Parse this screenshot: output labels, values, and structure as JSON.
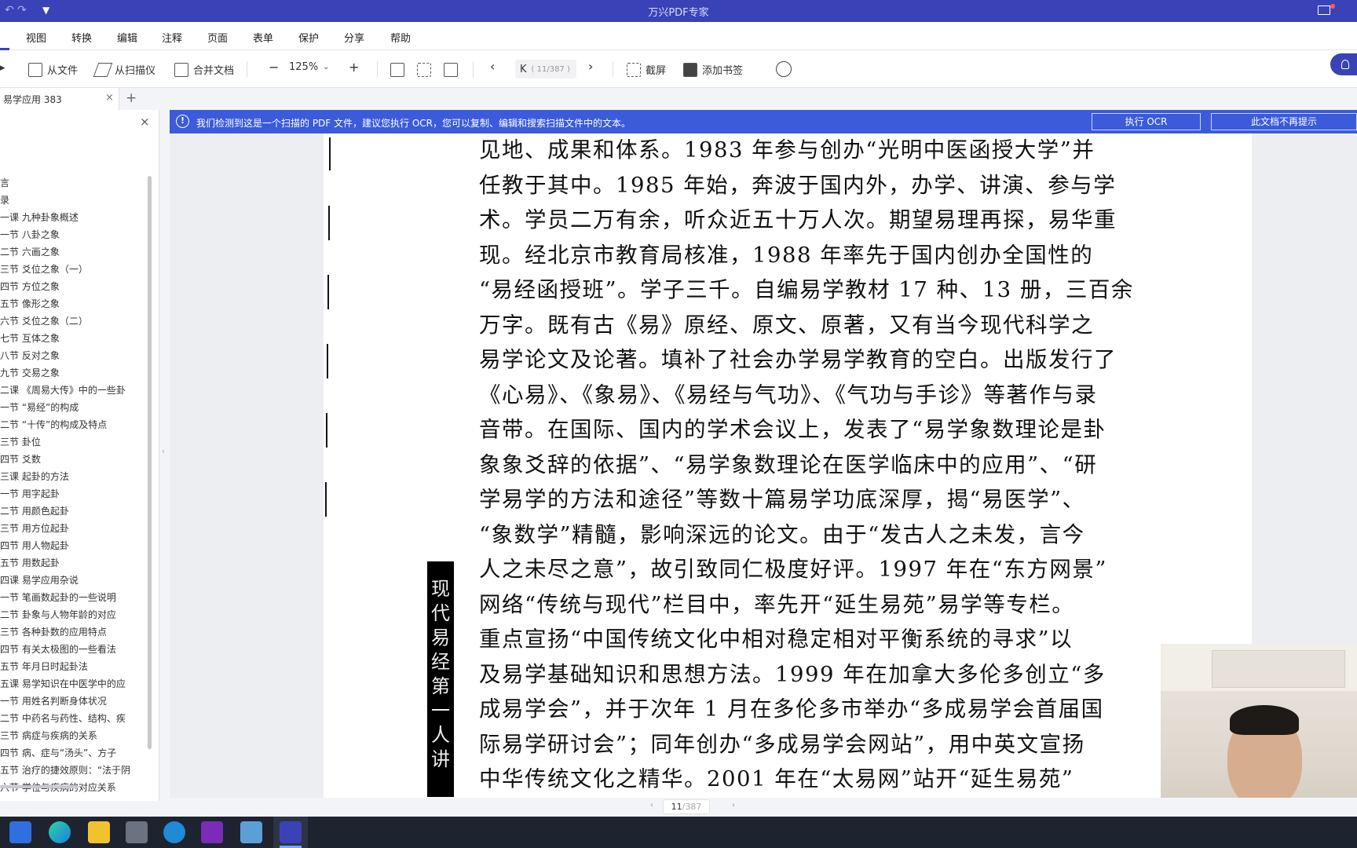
{
  "app": {
    "title": "万兴PDF专家"
  },
  "menu": {
    "items": [
      "视图",
      "转换",
      "编辑",
      "注释",
      "页面",
      "表单",
      "保护",
      "分享",
      "帮助"
    ]
  },
  "toolbar": {
    "from_file": "从文件",
    "from_scanner": "从扫描仪",
    "merge_docs": "合并文档",
    "zoom_minus": "−",
    "zoom_value": "125%",
    "zoom_plus": "+",
    "page_prev": "‹",
    "page_k": "K",
    "page_value": "( 11/387 )",
    "page_next": "›",
    "screenshot": "截屏",
    "add_bookmark": "添加书签"
  },
  "tab": {
    "label": "易学应用 383",
    "close": "×",
    "add": "+"
  },
  "sidebar": {
    "close": "×",
    "items": [
      "言",
      "录",
      "一课 九种卦象概述",
      "一节 八卦之象",
      "二节 六画之象",
      "三节 爻位之象（一）",
      "四节 方位之象",
      "五节 像形之象",
      "六节 爻位之象（二）",
      "七节 互体之象",
      "八节 反对之象",
      "九节 交易之象",
      "二课 《周易大传》中的一些卦",
      "一节 “易经”的构成",
      "二节 “十传”的构成及特点",
      "三节 卦位",
      "四节 爻数",
      "三课 起卦的方法",
      "一节 用字起卦",
      "二节 用颜色起卦",
      "三节 用方位起卦",
      "四节 用人物起卦",
      "五节 用数起卦",
      "四课 易学应用杂说",
      "一节 笔画数起卦的一些说明",
      "二节 卦象与人物年龄的对应",
      "三节 各种卦数的应用特点",
      "四节 有关太极图的一些看法",
      "五节 年月日时起卦法",
      "五课 易学知识在中医学中的应",
      "一节 用姓名判断身体状况",
      "二节 中药名与药性、结构、疾",
      "三节 病症与疾病的关系",
      "四节 病、症与“汤头”、方子",
      "五节 治疗的捷效原则：“法于阴",
      "六节 学位与疾病的对应关系"
    ]
  },
  "ocr_notice": {
    "message": "我们检测到这是一个扫描的 PDF 文件，建议您执行 OCR，您可以复制、编辑和搜索扫描文件中的文本。",
    "run_button": "执行 OCR",
    "dismiss_button": "此文档不再提示"
  },
  "document": {
    "lines": [
      "见地、成果和体系。1983 年参与创办“光明中医函授大学”并",
      "任教于其中。1985 年始，奔波于国内外，办学、讲演、参与学",
      "术。学员二万有余，听众近五十万人次。期望易理再探，易华重",
      "现。经北京市教育局核准，1988 年率先于国内创办全国性的",
      "“易经函授班”。学子三千。自编易学教材 17 种、13 册，三百余",
      "万字。既有古《易》原经、原文、原著，又有当今现代科学之",
      "易学论文及论著。填补了社会办学易学教育的空白。出版发行了",
      "《心易》、《象易》、《易经与气功》、《气功与手诊》等著作与录",
      "音带。在国际、国内的学术会议上，发表了“易学象数理论是卦",
      "象象爻辞的依据”、“易学象数理论在医学临床中的应用”、“研",
      "学易学的方法和途径”等数十篇易学功底深厚，揭“易医学”、",
      "“象数学”精髓，影响深远的论文。由于“发古人之未发，言今",
      "人之未尽之意”，故引致同仁极度好评。1997 年在“东方网景”",
      "网络“传统与现代”栏目中，率先开“延生易苑”易学等专栏。",
      "重点宣扬“中国传统文化中相对稳定相对平衡系统的寻求”以",
      "及易学基础知识和思想方法。1999 年在加拿大多伦多创立“多",
      "成易学会”，并于次年 1 月在多伦多市举办“多成易学会首届国",
      "际易学研讨会”；同年创办“多成易学会网站”，用中英文宣扬",
      "中华传统文化之精华。2001 年在“太易网”站开“延生易苑”"
    ],
    "vertical_text": "现代易经第一人讲"
  },
  "statusbar": {
    "page_current": "11",
    "page_total": "/387"
  },
  "colors": {
    "titlebar": "#3a42b8",
    "ocr_bar": "#3b5bdb"
  }
}
